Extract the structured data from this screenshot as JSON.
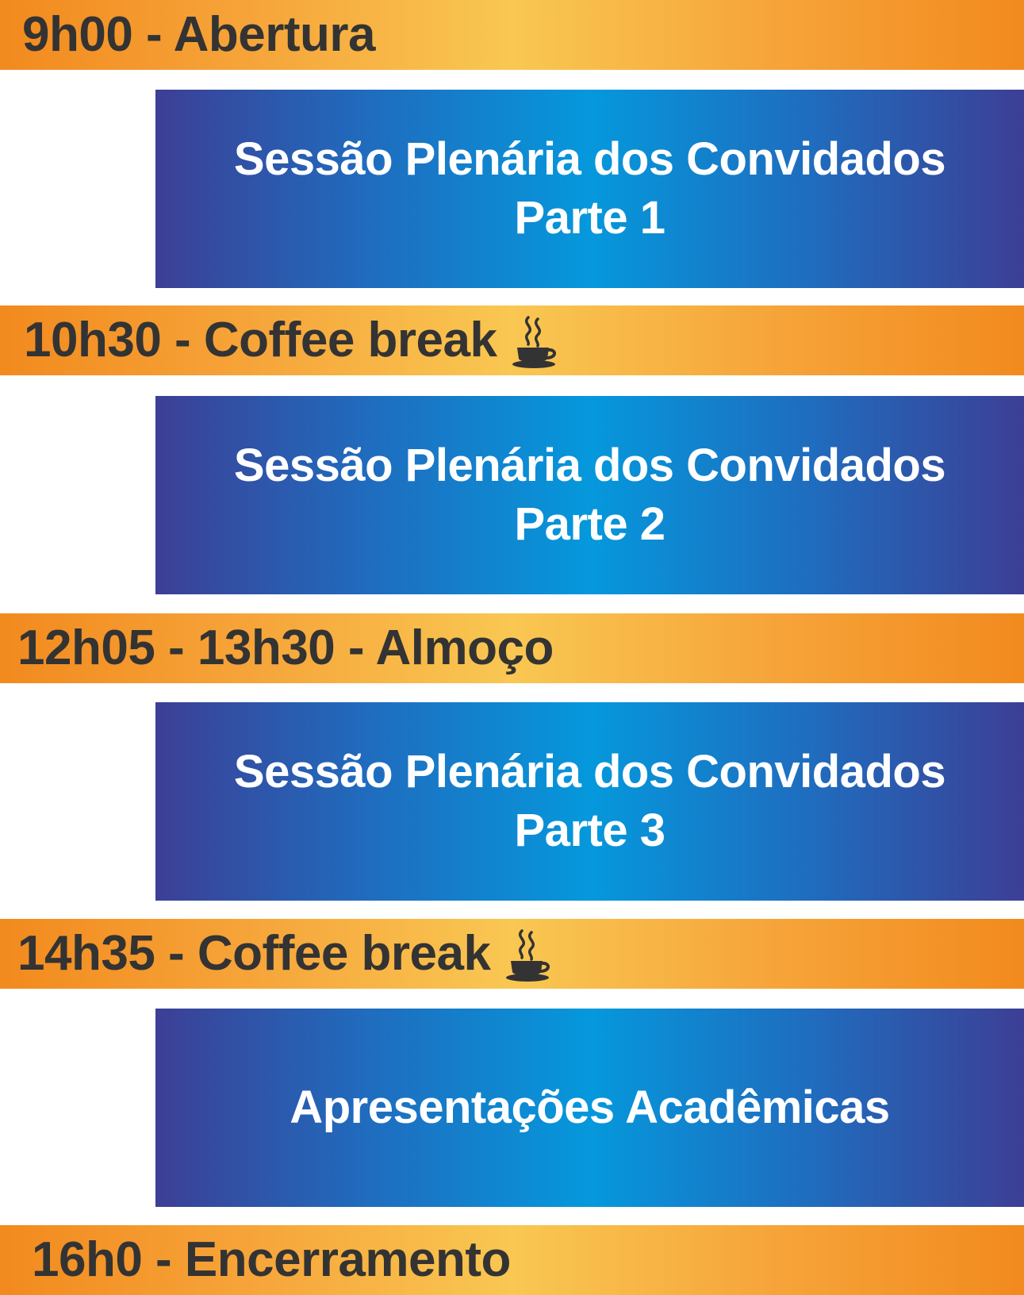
{
  "schedule": {
    "opening": {
      "label": "9h00 - Abertura"
    },
    "session1": {
      "line1": "Sessão Plenária dos Convidados",
      "line2": "Parte 1"
    },
    "break1": {
      "label": "10h30 - Coffee break",
      "icon": "coffee-cup-icon"
    },
    "session2": {
      "line1": "Sessão Plenária dos Convidados",
      "line2": "Parte 2"
    },
    "lunch": {
      "label": "12h05 - 13h30 - Almoço"
    },
    "session3": {
      "line1": "Sessão Plenária dos Convidados",
      "line2": "Parte 3"
    },
    "break2": {
      "label": "14h35 - Coffee break",
      "icon": "coffee-cup-icon"
    },
    "session4": {
      "line1": "Apresentações Acadêmicas"
    },
    "closing": {
      "label": "16h0 - Encerramento"
    }
  },
  "colors": {
    "bar_orange": "#f28a1e",
    "bar_yellow": "#f9c752",
    "session_blue_edge": "#3c3f95",
    "session_blue_center": "#0598dc",
    "bar_text": "#333333",
    "session_text": "#ffffff"
  }
}
